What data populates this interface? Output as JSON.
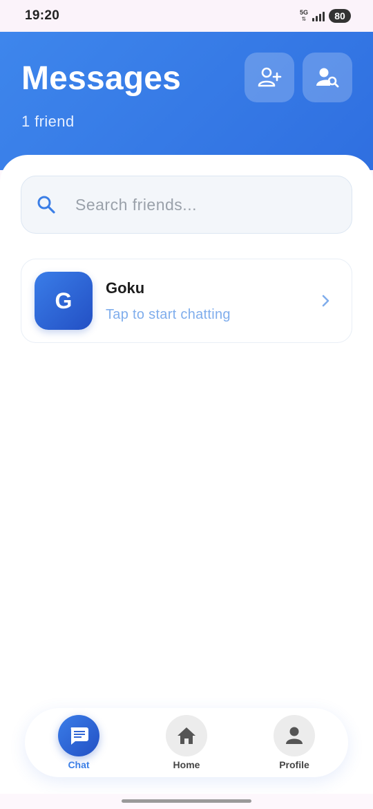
{
  "status_bar": {
    "time": "19:20",
    "network": "5G",
    "battery": "80"
  },
  "header": {
    "title": "Messages",
    "subtitle": "1 friend",
    "add_friend_icon": "person-add-icon",
    "find_friend_icon": "person-search-icon"
  },
  "search": {
    "placeholder": "Search friends...",
    "value": "",
    "icon": "search-icon"
  },
  "friends": [
    {
      "initial": "G",
      "name": "Goku",
      "status": "Tap to start chatting"
    }
  ],
  "bottom_nav": {
    "items": [
      {
        "label": "Chat",
        "icon": "chat-bubble-icon",
        "active": true
      },
      {
        "label": "Home",
        "icon": "home-icon",
        "active": false
      },
      {
        "label": "Profile",
        "icon": "person-icon",
        "active": false
      }
    ]
  },
  "colors": {
    "primary": "#3b7ee6",
    "primary_dark": "#2350c4",
    "status_text": "#7fadec"
  }
}
